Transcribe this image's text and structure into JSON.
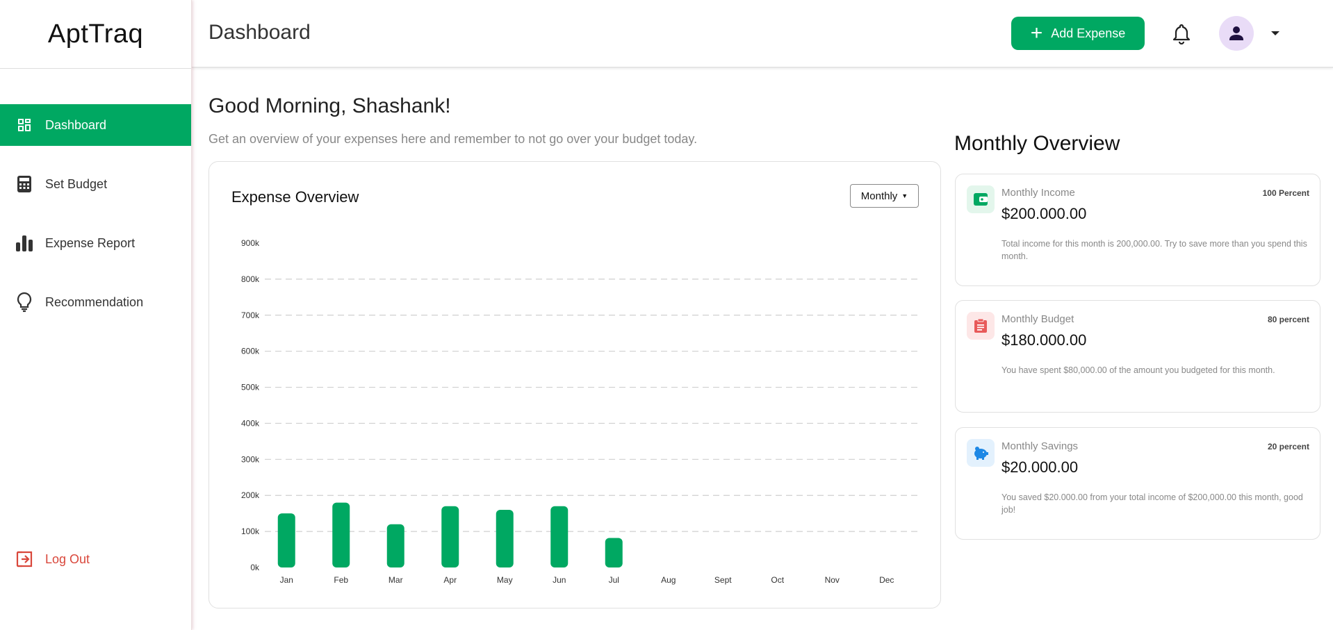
{
  "app": {
    "brand": "AptTraq"
  },
  "sidebar": {
    "items": [
      {
        "label": "Dashboard",
        "icon": "dashboard-icon",
        "active": true
      },
      {
        "label": "Set Budget",
        "icon": "calculator-icon",
        "active": false
      },
      {
        "label": "Expense Report",
        "icon": "bar-chart-icon",
        "active": false
      },
      {
        "label": "Recommendation",
        "icon": "lightbulb-icon",
        "active": false
      }
    ],
    "logout_label": "Log Out"
  },
  "header": {
    "title": "Dashboard",
    "add_expense_label": "Add Expense"
  },
  "main": {
    "greeting": "Good Morning, Shashank!",
    "subtitle": "Get an overview of your expenses here and remember to not go over your budget today.",
    "chart_card": {
      "title": "Expense Overview",
      "period": "Monthly"
    }
  },
  "overview": {
    "title": "Monthly Overview",
    "cards": [
      {
        "label": "Monthly Income",
        "percent": "100 Percent",
        "amount": "$200.000.00",
        "desc": "Total income for this month is 200,000.00. Try to save more than you spend this month.",
        "icon": "wallet-icon",
        "color": "#00a862",
        "bg": "#e3f6ec"
      },
      {
        "label": "Monthly Budget",
        "percent": "80 percent",
        "amount": "$180.000.00",
        "desc": "You have spent $80,000.00 of the amount you budgeted for this month.",
        "icon": "clipboard-icon",
        "color": "#e85a5a",
        "bg": "#fde7e7"
      },
      {
        "label": "Monthly Savings",
        "percent": "20 percent",
        "amount": "$20.000.00",
        "desc": "You saved $20.000.00 from your total income of $200,000.00 this month, good job!",
        "icon": "piggy-bank-icon",
        "color": "#1e88e5",
        "bg": "#e3f1fd"
      }
    ]
  },
  "colors": {
    "accent": "#00a862",
    "danger": "#d9473b",
    "avatar_bg": "#e9dcf7"
  },
  "chart_data": {
    "type": "bar",
    "categories": [
      "Jan",
      "Feb",
      "Mar",
      "Apr",
      "May",
      "Jun",
      "Jul",
      "Aug",
      "Sept",
      "Oct",
      "Nov",
      "Dec"
    ],
    "values": [
      150000,
      180000,
      120000,
      170000,
      160000,
      170000,
      82000,
      0,
      0,
      0,
      0,
      0
    ],
    "ylim": [
      0,
      900000
    ],
    "yticks": [
      "0k",
      "100k",
      "200k",
      "300k",
      "400k",
      "500k",
      "600k",
      "700k",
      "800k",
      "900k"
    ],
    "grid": true,
    "bar_color": "#00a862"
  }
}
